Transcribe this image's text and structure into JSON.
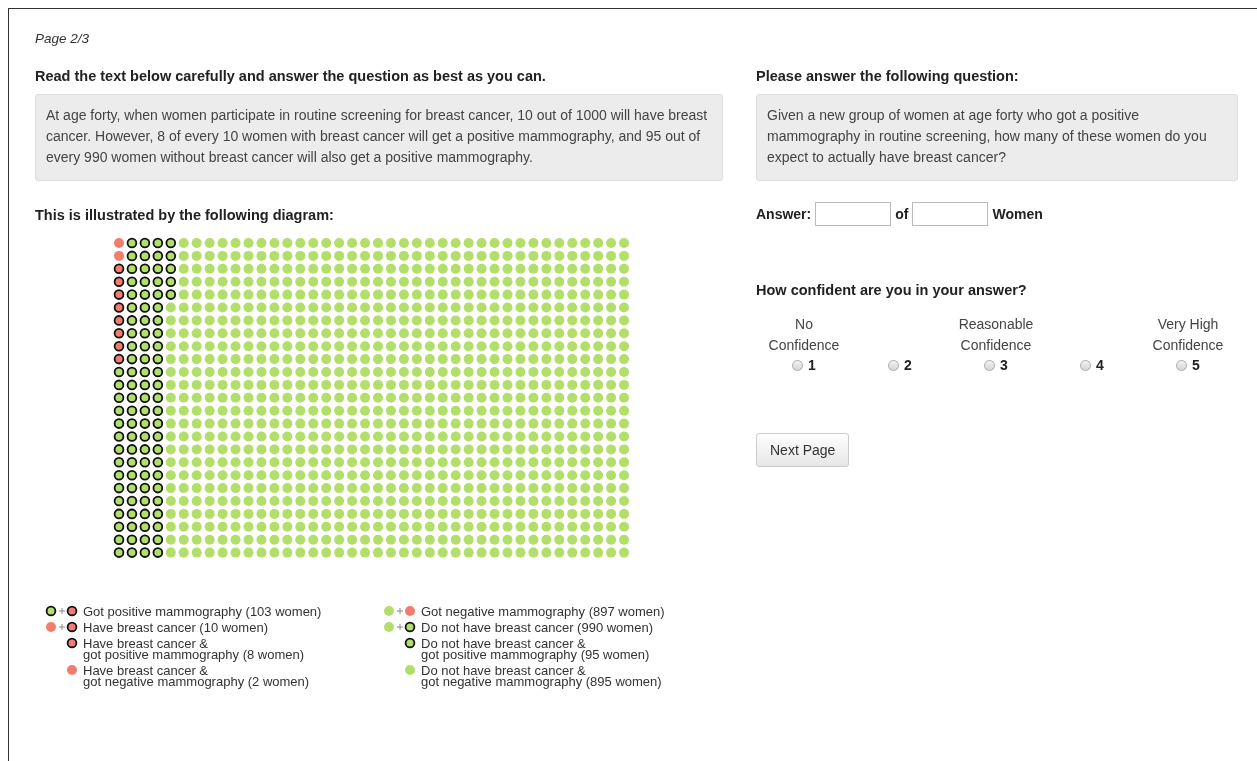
{
  "page_indicator": "Page 2/3",
  "left": {
    "heading": "Read the text below carefully and answer the question as best as you can.",
    "scenario": "At age forty, when women participate in routine screening for breast cancer, 10 out of 1000 will have breast cancer. However, 8 of every 10 women with breast cancer will get a positive mammography, and 95 out of every 990 women without breast cancer will also get a positive mammography.",
    "diagram_heading": "This is illustrated by the following diagram:",
    "legend": [
      {
        "kind": "positive",
        "lines": [
          "Got positive mammography (103 women)"
        ]
      },
      {
        "kind": "negative",
        "lines": [
          "Got negative mammography (897 women)"
        ]
      },
      {
        "kind": "cancer",
        "lines": [
          "Have breast cancer (10 women)"
        ]
      },
      {
        "kind": "healthy",
        "lines": [
          "Do not have breast cancer (990 women)"
        ]
      },
      {
        "kind": "cancer-positive",
        "lines": [
          "Have breast cancer &",
          "got positive mammography (8 women)"
        ]
      },
      {
        "kind": "healthy-positive",
        "lines": [
          "Do not have breast cancer &",
          "got positive mammography (95 women)"
        ]
      },
      {
        "kind": "cancer-negative",
        "lines": [
          "Have breast cancer &",
          "got negative mammography (2 women)"
        ]
      },
      {
        "kind": "healthy-negative",
        "lines": [
          "Do not have breast cancer &",
          "got negative mammography (895 women)"
        ]
      }
    ]
  },
  "right": {
    "heading": "Please answer the following question:",
    "question": "Given a new group of women at age forty who got a positive mammography in routine screening, how many of these women do you expect to actually have breast cancer?",
    "answer_label": "Answer:",
    "of_label": "of",
    "women_label": "Women",
    "confidence_heading": "How confident are you in your answer?",
    "scale": [
      {
        "caption": [
          "No",
          "Confidence"
        ],
        "value": "1",
        "selected": false
      },
      {
        "value": "2",
        "selected": false
      },
      {
        "caption": [
          "Reasonable",
          "Confidence"
        ],
        "value": "3",
        "selected": false
      },
      {
        "value": "4",
        "selected": false
      },
      {
        "caption": [
          "Very High",
          "Confidence"
        ],
        "value": "5",
        "selected": false
      }
    ],
    "next_button": "Next Page"
  }
}
